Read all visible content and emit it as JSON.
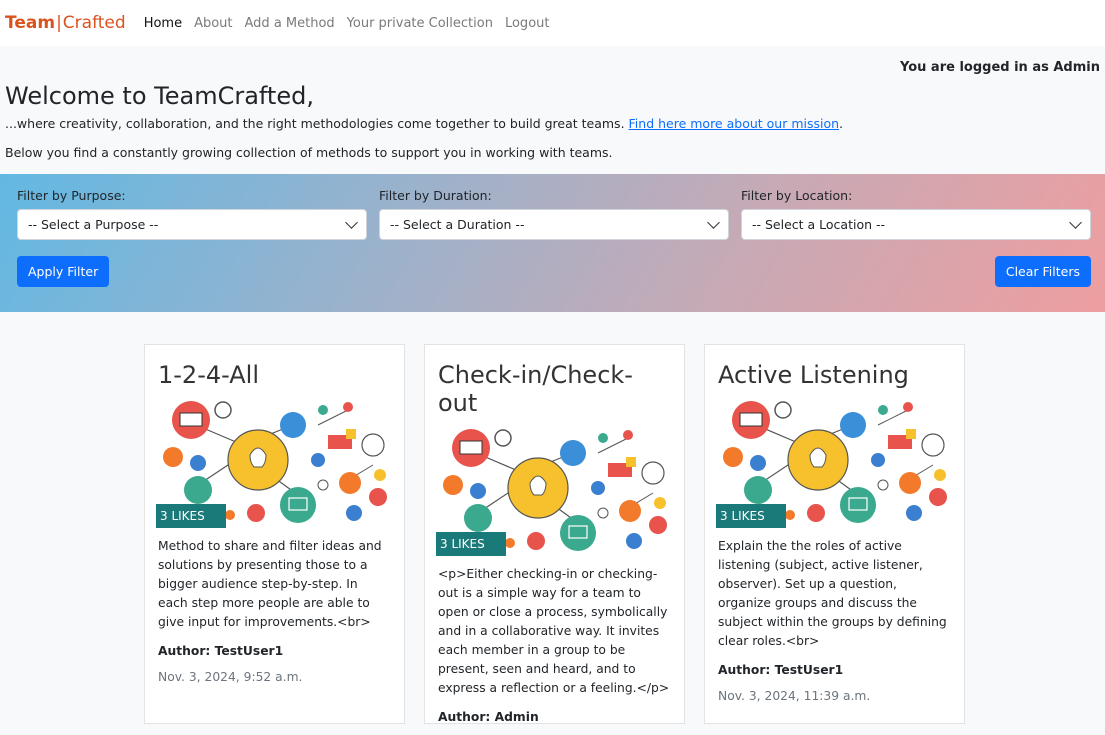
{
  "nav": {
    "brand_bold": "Team",
    "brand_sep": "|",
    "brand_rest": "Crafted",
    "links": [
      "Home",
      "About",
      "Add a Method",
      "Your private Collection",
      "Logout"
    ]
  },
  "login_status": "You are logged in as Admin",
  "welcome": {
    "title": "Welcome to TeamCrafted,",
    "intro": "...where creativity, collaboration, and the right methodologies come together to build great teams. ",
    "mission_link": "Find here more about our mission",
    "intro_end": ".",
    "subtitle": "Below you find a constantly growing collection of methods to support you in working with teams."
  },
  "filters": {
    "purpose": {
      "label": "Filter by Purpose:",
      "value": "-- Select a Purpose --"
    },
    "duration": {
      "label": "Filter by Duration:",
      "value": "-- Select a Duration --"
    },
    "location": {
      "label": "Filter by Location:",
      "value": "-- Select a Location --"
    },
    "apply_label": "Apply Filter",
    "clear_label": "Clear Filters"
  },
  "cards": [
    {
      "title": "1-2-4-All",
      "likes": "3 LIKES",
      "description": "Method to share and filter ideas and solutions by presenting those to a bigger audience step-by-step. In each step more people are able to give input for improvements.<br>",
      "author": "Author: TestUser1",
      "date": "Nov. 3, 2024, 9:52 a.m."
    },
    {
      "title": "Check-in/Check-out",
      "likes": "3 LIKES",
      "description": "<p>Either checking-in or checking-out is a simple way for a team to open or close a process, symbolically and in a collaborative way. It invites each member in a group to be present, seen and heard, and to express a reflection or a feeling.</p>",
      "author": "Author: Admin",
      "date": ""
    },
    {
      "title": "Active Listening",
      "likes": "3 LIKES",
      "description": "Explain the the roles of active listening (subject, active listener, observer). Set up a question, organize groups and discuss the subject within the groups by defining clear roles.<br>",
      "author": "Author: TestUser1",
      "date": "Nov. 3, 2024, 11:39 a.m."
    }
  ]
}
